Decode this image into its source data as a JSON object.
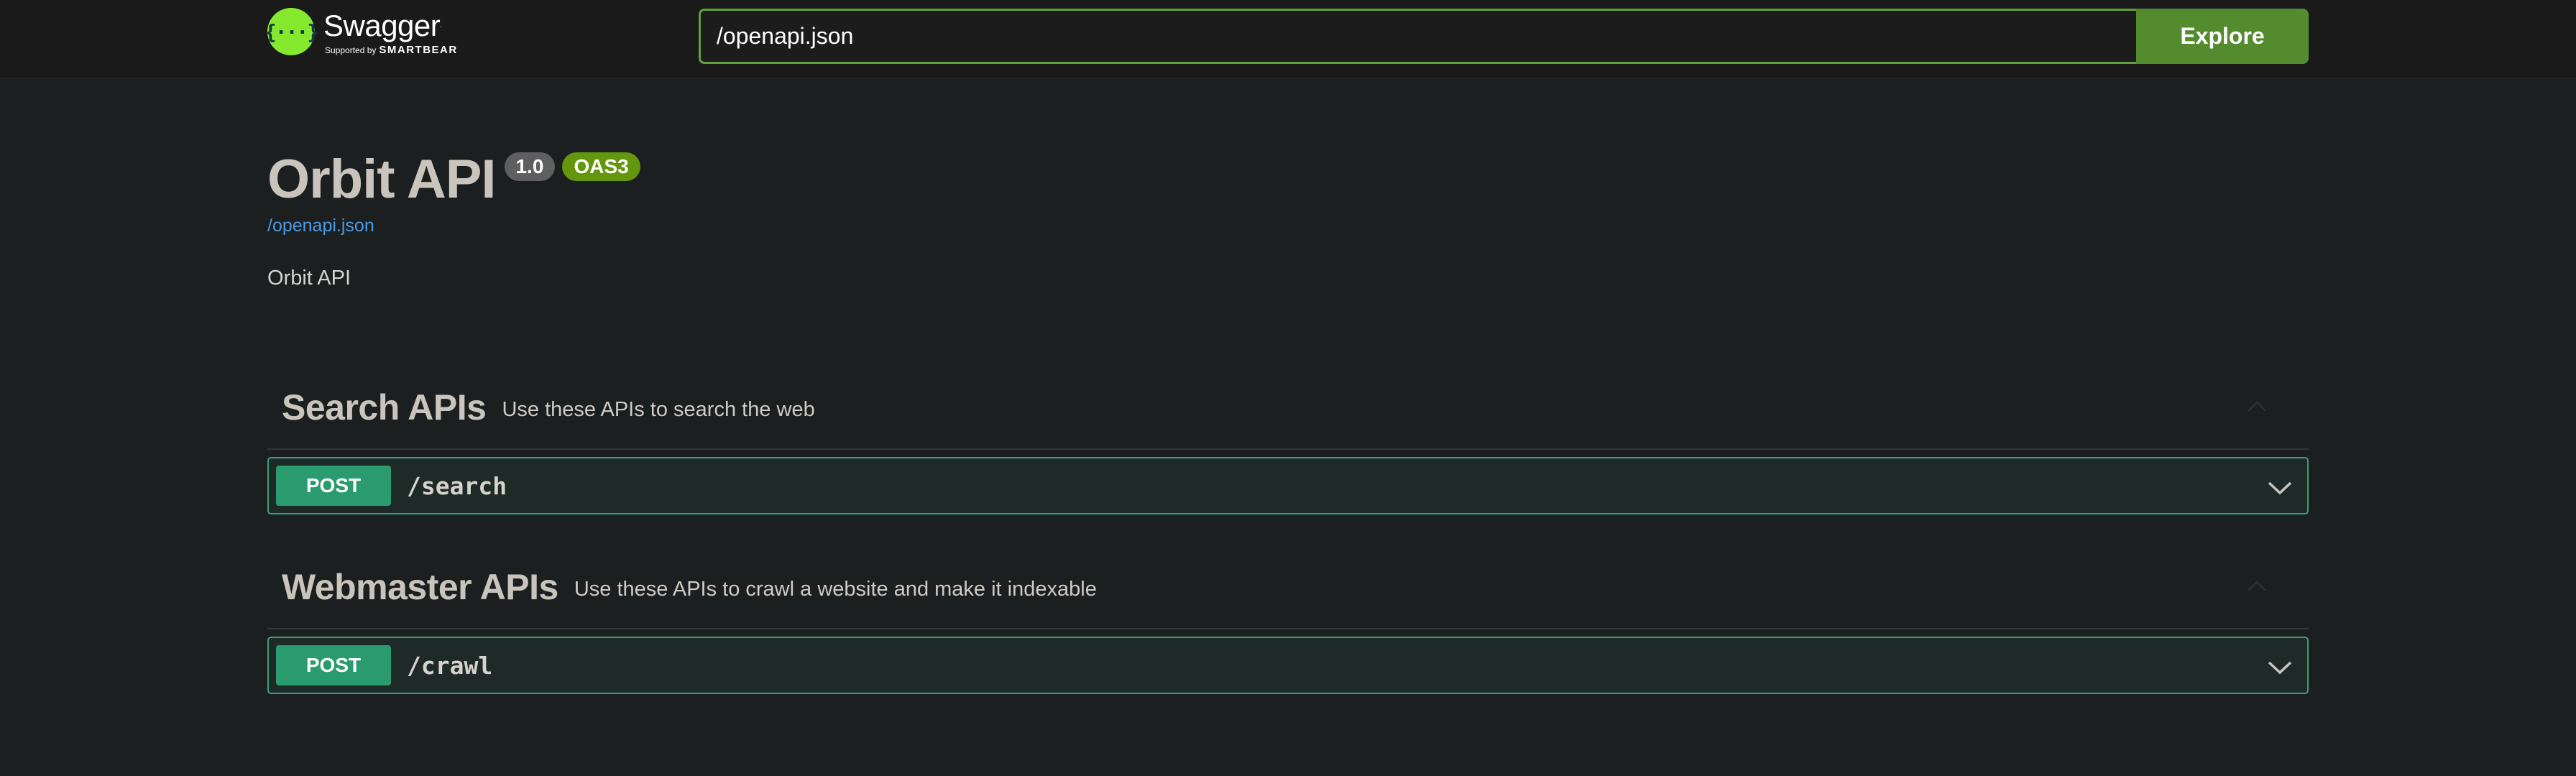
{
  "header": {
    "logo_title": "Swagger",
    "logo_supported": "Supported by",
    "logo_brand": "SMARTBEAR",
    "logo_badge_glyph": "{···}",
    "url_value": "/openapi.json",
    "explore_label": "Explore",
    "accent_color": "#85ea2d",
    "button_color": "#558b2f"
  },
  "info": {
    "title": "Orbit API",
    "version": "1.0",
    "oas_badge": "OAS3",
    "spec_link": "/openapi.json",
    "description": "Orbit API"
  },
  "tags": [
    {
      "name": "Search APIs",
      "description": "Use these APIs to search the web",
      "expanded": true,
      "operations": [
        {
          "method": "POST",
          "path": "/search"
        }
      ]
    },
    {
      "name": "Webmaster APIs",
      "description": "Use these APIs to crawl a website and make it indexable",
      "expanded": true,
      "operations": [
        {
          "method": "POST",
          "path": "/crawl"
        }
      ]
    }
  ],
  "icons": {
    "logo": "swagger-logo-icon",
    "tag_toggle": "chevron-up-icon",
    "op_toggle": "chevron-down-icon"
  },
  "colors": {
    "post_method": "#2a9b6f",
    "post_border": "#3aa173",
    "oas_badge": "#64960e",
    "version_badge": "#5f5f5f",
    "link": "#4b9ae0"
  }
}
